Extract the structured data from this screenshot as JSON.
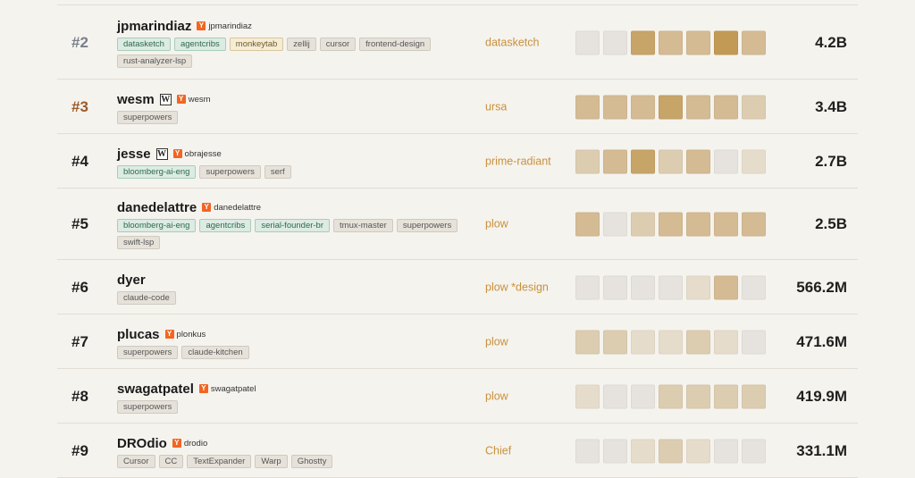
{
  "palette": [
    "#e6e3de",
    "#e6dccb",
    "#dccdb1",
    "#d4bb94",
    "#c7a468",
    "#c39a55"
  ],
  "rows": [
    {
      "rank": "#2",
      "rank_style": "r2",
      "name": "jpmarindiaz",
      "wiki": false,
      "yc_handle": "jpmarindiaz",
      "tags": [
        {
          "t": "datasketch",
          "k": "green"
        },
        {
          "t": "agentcribs",
          "k": "green"
        },
        {
          "t": "monkeytab",
          "k": "yellow"
        },
        {
          "t": "zellij",
          "k": ""
        },
        {
          "t": "cursor",
          "k": ""
        },
        {
          "t": "frontend-design",
          "k": ""
        },
        {
          "t": "rust-analyzer-lsp",
          "k": ""
        }
      ],
      "team": "datasketch",
      "levels": [
        0,
        0,
        4,
        3,
        3,
        5,
        3
      ],
      "total": "4.2B"
    },
    {
      "rank": "#3",
      "rank_style": "r3",
      "name": "wesm",
      "wiki": true,
      "yc_handle": "wesm",
      "tags": [
        {
          "t": "superpowers",
          "k": ""
        }
      ],
      "team": "ursa",
      "levels": [
        3,
        3,
        3,
        4,
        3,
        3,
        2
      ],
      "total": "3.4B"
    },
    {
      "rank": "#4",
      "rank_style": "rn",
      "name": "jesse",
      "wiki": true,
      "yc_handle": "obrajesse",
      "tags": [
        {
          "t": "bloomberg-ai-eng",
          "k": "green"
        },
        {
          "t": "superpowers",
          "k": ""
        },
        {
          "t": "serf",
          "k": ""
        }
      ],
      "team": "prime-radiant",
      "levels": [
        2,
        3,
        4,
        2,
        3,
        0,
        1
      ],
      "total": "2.7B"
    },
    {
      "rank": "#5",
      "rank_style": "rn",
      "name": "danedelattre",
      "wiki": false,
      "yc_handle": "danedelattre",
      "tags": [
        {
          "t": "bloomberg-ai-eng",
          "k": "green"
        },
        {
          "t": "agentcribs",
          "k": "green"
        },
        {
          "t": "serial-founder-br",
          "k": "green"
        },
        {
          "t": "tmux-master",
          "k": ""
        },
        {
          "t": "superpowers",
          "k": ""
        },
        {
          "t": "swift-lsp",
          "k": ""
        }
      ],
      "team": "plow",
      "levels": [
        3,
        0,
        2,
        3,
        3,
        3,
        3
      ],
      "total": "2.5B"
    },
    {
      "rank": "#6",
      "rank_style": "rn",
      "name": "dyer",
      "wiki": false,
      "yc_handle": "",
      "tags": [
        {
          "t": "claude-code",
          "k": ""
        }
      ],
      "team": "plow *design",
      "levels": [
        0,
        0,
        0,
        0,
        1,
        3,
        0
      ],
      "total": "566.2M"
    },
    {
      "rank": "#7",
      "rank_style": "rn",
      "name": "plucas",
      "wiki": false,
      "yc_handle": "plonkus",
      "tags": [
        {
          "t": "superpowers",
          "k": ""
        },
        {
          "t": "claude-kitchen",
          "k": ""
        }
      ],
      "team": "plow",
      "levels": [
        2,
        2,
        1,
        1,
        2,
        1,
        0
      ],
      "total": "471.6M"
    },
    {
      "rank": "#8",
      "rank_style": "rn",
      "name": "swagatpatel",
      "wiki": false,
      "yc_handle": "swagatpatel",
      "tags": [
        {
          "t": "superpowers",
          "k": ""
        }
      ],
      "team": "plow",
      "levels": [
        1,
        0,
        0,
        2,
        2,
        2,
        2
      ],
      "total": "419.9M"
    },
    {
      "rank": "#9",
      "rank_style": "rn",
      "name": "DROdio",
      "wiki": false,
      "yc_handle": "drodio",
      "tags": [
        {
          "t": "Cursor",
          "k": ""
        },
        {
          "t": "CC",
          "k": ""
        },
        {
          "t": "TextExpander",
          "k": ""
        },
        {
          "t": "Warp",
          "k": ""
        },
        {
          "t": "Ghostty",
          "k": ""
        }
      ],
      "team": "Chief",
      "levels": [
        0,
        0,
        1,
        2,
        1,
        0,
        0
      ],
      "total": "331.1M"
    }
  ]
}
